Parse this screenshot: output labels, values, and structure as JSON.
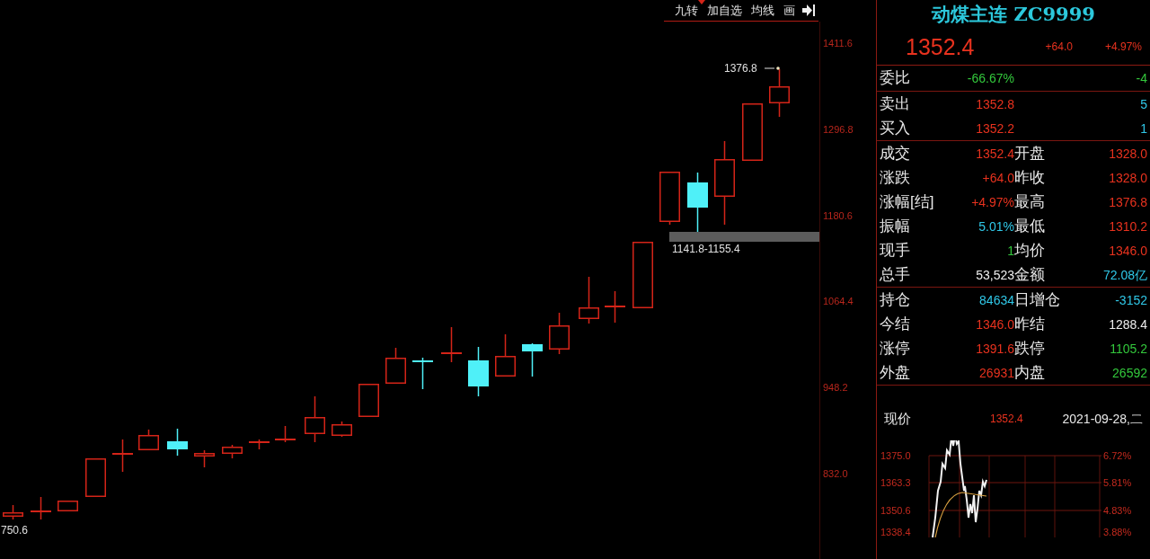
{
  "toolbar": {
    "items": [
      {
        "label": "九转"
      },
      {
        "label": "加自选"
      },
      {
        "label": "均线"
      },
      {
        "label": "画"
      }
    ]
  },
  "kline_chart": {
    "y_axis_labels": [
      "1411.6",
      "1296.8",
      "1180.6",
      "1064.4",
      "948.2",
      "832.0"
    ],
    "high_label": "1376.8",
    "range_label": "1141.8-1155.4",
    "low_label": "750.6"
  },
  "quote_panel": {
    "title": "动煤主连 ZC9999",
    "price": "1352.4",
    "change": "+64.0",
    "change_percent": "+4.97%",
    "sections": [
      {
        "rows": [
          {
            "cells": [
              {
                "label": "委比",
                "value": "-66.67%",
                "color": "#33c83c"
              },
              {
                "value": "-4",
                "color": "#33c83c"
              }
            ]
          }
        ]
      },
      {
        "rows": [
          {
            "cells": [
              {
                "label": "卖出",
                "value": "1352.8",
                "color": "#e8321e"
              },
              {
                "value": "5",
                "color": "#30c8e8"
              }
            ]
          },
          {
            "cells": [
              {
                "label": "买入",
                "value": "1352.2",
                "color": "#e8321e"
              },
              {
                "value": "1",
                "color": "#30c8e8"
              }
            ]
          }
        ]
      },
      {
        "rows": [
          {
            "cells": [
              {
                "label": "成交",
                "value": "1352.4",
                "color": "#e8321e"
              },
              {
                "label": "开盘",
                "value": "1328.0",
                "color": "#e8321e"
              }
            ]
          },
          {
            "cells": [
              {
                "label": "涨跌",
                "value": "+64.0",
                "color": "#e8321e"
              },
              {
                "label": "昨收",
                "value": "1328.0",
                "color": "#e8321e"
              }
            ]
          },
          {
            "cells": [
              {
                "label": "涨幅[结]",
                "value": "+4.97%",
                "color": "#e8321e"
              },
              {
                "label": "最高",
                "value": "1376.8",
                "color": "#e8321e"
              }
            ]
          },
          {
            "cells": [
              {
                "label": "振幅",
                "value": "5.01%",
                "color": "#30c8e8"
              },
              {
                "label": "最低",
                "value": "1310.2",
                "color": "#e8321e"
              }
            ]
          },
          {
            "cells": [
              {
                "label": "现手",
                "value": "1",
                "color": "#33c83c"
              },
              {
                "label": "均价",
                "value": "1346.0",
                "color": "#e8321e"
              }
            ]
          },
          {
            "cells": [
              {
                "label": "总手",
                "value": "53,523",
                "color": "#eeeeee"
              },
              {
                "label": "金额",
                "value": "72.08亿",
                "color": "#30c8e8"
              }
            ]
          }
        ]
      },
      {
        "rows": [
          {
            "cells": [
              {
                "label": "持仓",
                "value": "84634",
                "color": "#30c8e8"
              },
              {
                "label": "日增仓",
                "value": "-3152",
                "color": "#30c8e8"
              }
            ]
          },
          {
            "cells": [
              {
                "label": "今结",
                "value": "1346.0",
                "color": "#e8321e"
              },
              {
                "label": "昨结",
                "value": "1288.4",
                "color": "#eeeeee"
              }
            ]
          },
          {
            "cells": [
              {
                "label": "涨停",
                "value": "1391.6",
                "color": "#e8321e"
              },
              {
                "label": "跌停",
                "value": "1105.2",
                "color": "#33c83c"
              }
            ]
          },
          {
            "cells": [
              {
                "label": "外盘",
                "value": "26931",
                "color": "#e8321e"
              },
              {
                "label": "内盘",
                "value": "26592",
                "color": "#33c83c"
              }
            ]
          }
        ]
      }
    ]
  },
  "current_price": {
    "label": "现价",
    "value": "1352.4",
    "date": "2021-09-28,二"
  },
  "intraday_chart": {
    "price_labels": [
      "1375.0",
      "1363.3",
      "1350.6",
      "1338.4"
    ],
    "percent_labels": [
      "6.72%",
      "5.81%",
      "4.83%",
      "3.88%"
    ]
  }
}
